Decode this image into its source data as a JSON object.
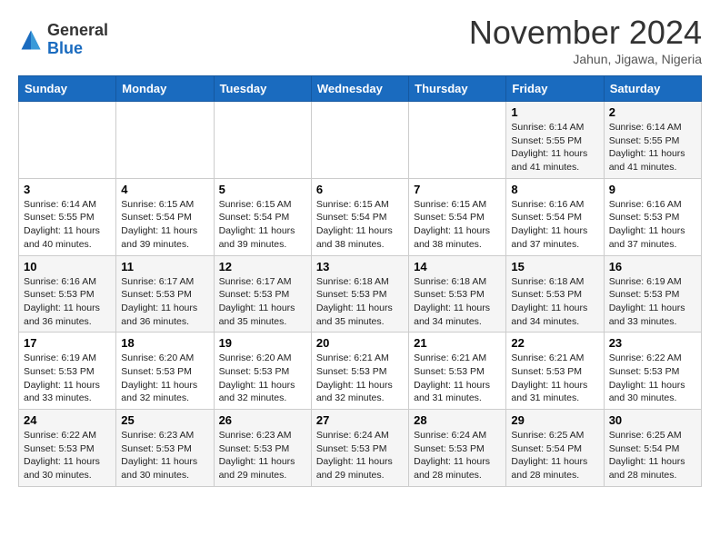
{
  "header": {
    "logo_line1": "General",
    "logo_line2": "Blue",
    "month_title": "November 2024",
    "location": "Jahun, Jigawa, Nigeria"
  },
  "weekdays": [
    "Sunday",
    "Monday",
    "Tuesday",
    "Wednesday",
    "Thursday",
    "Friday",
    "Saturday"
  ],
  "weeks": [
    [
      {
        "day": "",
        "info": ""
      },
      {
        "day": "",
        "info": ""
      },
      {
        "day": "",
        "info": ""
      },
      {
        "day": "",
        "info": ""
      },
      {
        "day": "",
        "info": ""
      },
      {
        "day": "1",
        "info": "Sunrise: 6:14 AM\nSunset: 5:55 PM\nDaylight: 11 hours\nand 41 minutes."
      },
      {
        "day": "2",
        "info": "Sunrise: 6:14 AM\nSunset: 5:55 PM\nDaylight: 11 hours\nand 41 minutes."
      }
    ],
    [
      {
        "day": "3",
        "info": "Sunrise: 6:14 AM\nSunset: 5:55 PM\nDaylight: 11 hours\nand 40 minutes."
      },
      {
        "day": "4",
        "info": "Sunrise: 6:15 AM\nSunset: 5:54 PM\nDaylight: 11 hours\nand 39 minutes."
      },
      {
        "day": "5",
        "info": "Sunrise: 6:15 AM\nSunset: 5:54 PM\nDaylight: 11 hours\nand 39 minutes."
      },
      {
        "day": "6",
        "info": "Sunrise: 6:15 AM\nSunset: 5:54 PM\nDaylight: 11 hours\nand 38 minutes."
      },
      {
        "day": "7",
        "info": "Sunrise: 6:15 AM\nSunset: 5:54 PM\nDaylight: 11 hours\nand 38 minutes."
      },
      {
        "day": "8",
        "info": "Sunrise: 6:16 AM\nSunset: 5:54 PM\nDaylight: 11 hours\nand 37 minutes."
      },
      {
        "day": "9",
        "info": "Sunrise: 6:16 AM\nSunset: 5:53 PM\nDaylight: 11 hours\nand 37 minutes."
      }
    ],
    [
      {
        "day": "10",
        "info": "Sunrise: 6:16 AM\nSunset: 5:53 PM\nDaylight: 11 hours\nand 36 minutes."
      },
      {
        "day": "11",
        "info": "Sunrise: 6:17 AM\nSunset: 5:53 PM\nDaylight: 11 hours\nand 36 minutes."
      },
      {
        "day": "12",
        "info": "Sunrise: 6:17 AM\nSunset: 5:53 PM\nDaylight: 11 hours\nand 35 minutes."
      },
      {
        "day": "13",
        "info": "Sunrise: 6:18 AM\nSunset: 5:53 PM\nDaylight: 11 hours\nand 35 minutes."
      },
      {
        "day": "14",
        "info": "Sunrise: 6:18 AM\nSunset: 5:53 PM\nDaylight: 11 hours\nand 34 minutes."
      },
      {
        "day": "15",
        "info": "Sunrise: 6:18 AM\nSunset: 5:53 PM\nDaylight: 11 hours\nand 34 minutes."
      },
      {
        "day": "16",
        "info": "Sunrise: 6:19 AM\nSunset: 5:53 PM\nDaylight: 11 hours\nand 33 minutes."
      }
    ],
    [
      {
        "day": "17",
        "info": "Sunrise: 6:19 AM\nSunset: 5:53 PM\nDaylight: 11 hours\nand 33 minutes."
      },
      {
        "day": "18",
        "info": "Sunrise: 6:20 AM\nSunset: 5:53 PM\nDaylight: 11 hours\nand 32 minutes."
      },
      {
        "day": "19",
        "info": "Sunrise: 6:20 AM\nSunset: 5:53 PM\nDaylight: 11 hours\nand 32 minutes."
      },
      {
        "day": "20",
        "info": "Sunrise: 6:21 AM\nSunset: 5:53 PM\nDaylight: 11 hours\nand 32 minutes."
      },
      {
        "day": "21",
        "info": "Sunrise: 6:21 AM\nSunset: 5:53 PM\nDaylight: 11 hours\nand 31 minutes."
      },
      {
        "day": "22",
        "info": "Sunrise: 6:21 AM\nSunset: 5:53 PM\nDaylight: 11 hours\nand 31 minutes."
      },
      {
        "day": "23",
        "info": "Sunrise: 6:22 AM\nSunset: 5:53 PM\nDaylight: 11 hours\nand 30 minutes."
      }
    ],
    [
      {
        "day": "24",
        "info": "Sunrise: 6:22 AM\nSunset: 5:53 PM\nDaylight: 11 hours\nand 30 minutes."
      },
      {
        "day": "25",
        "info": "Sunrise: 6:23 AM\nSunset: 5:53 PM\nDaylight: 11 hours\nand 30 minutes."
      },
      {
        "day": "26",
        "info": "Sunrise: 6:23 AM\nSunset: 5:53 PM\nDaylight: 11 hours\nand 29 minutes."
      },
      {
        "day": "27",
        "info": "Sunrise: 6:24 AM\nSunset: 5:53 PM\nDaylight: 11 hours\nand 29 minutes."
      },
      {
        "day": "28",
        "info": "Sunrise: 6:24 AM\nSunset: 5:53 PM\nDaylight: 11 hours\nand 28 minutes."
      },
      {
        "day": "29",
        "info": "Sunrise: 6:25 AM\nSunset: 5:54 PM\nDaylight: 11 hours\nand 28 minutes."
      },
      {
        "day": "30",
        "info": "Sunrise: 6:25 AM\nSunset: 5:54 PM\nDaylight: 11 hours\nand 28 minutes."
      }
    ]
  ]
}
